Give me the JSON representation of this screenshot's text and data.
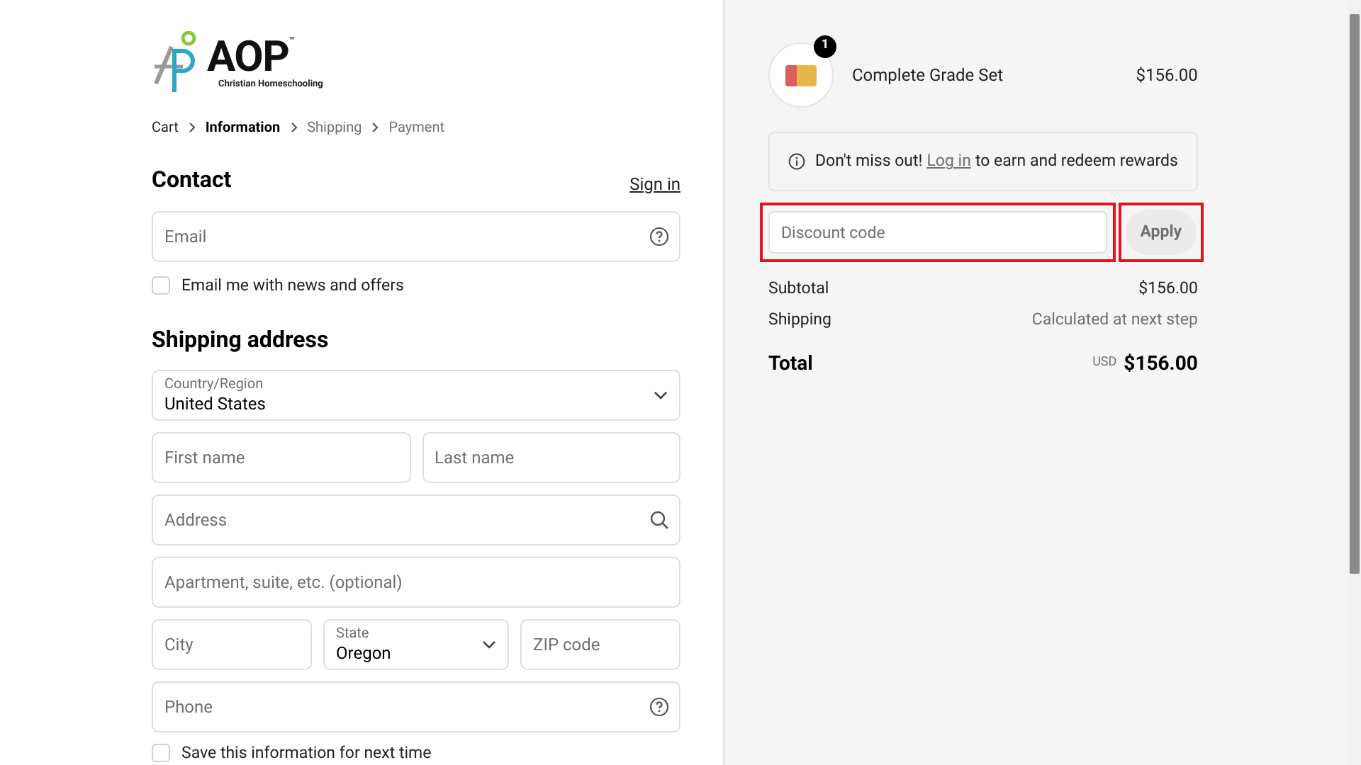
{
  "logo": {
    "name": "AOP",
    "trademark": "™",
    "tagline": "Christian Homeschooling"
  },
  "breadcrumb": [
    {
      "label": "Cart",
      "selected": false,
      "completed": true
    },
    {
      "label": "Information",
      "selected": true,
      "completed": false
    },
    {
      "label": "Shipping",
      "selected": false,
      "completed": false
    },
    {
      "label": "Payment",
      "selected": false,
      "completed": false
    }
  ],
  "contact": {
    "heading": "Contact",
    "sign_in": "Sign in",
    "email": {
      "kind": "help",
      "placeholder": "Email"
    },
    "newsletter": {
      "label": "Email me with news and offers",
      "checked": false
    }
  },
  "shipping": {
    "heading": "Shipping address",
    "rows": [
      [
        {
          "kind": "select",
          "label": "Country/Region",
          "value": "United States"
        }
      ],
      [
        {
          "kind": "text",
          "placeholder": "First name"
        },
        {
          "kind": "text",
          "placeholder": "Last name"
        }
      ],
      [
        {
          "kind": "search",
          "placeholder": "Address"
        }
      ],
      [
        {
          "kind": "text",
          "placeholder": "Apartment, suite, etc. (optional)"
        }
      ],
      [
        {
          "kind": "text",
          "placeholder": "City"
        },
        {
          "kind": "select",
          "label": "State",
          "value": "Oregon"
        },
        {
          "kind": "text",
          "placeholder": "ZIP code"
        }
      ],
      [
        {
          "kind": "help",
          "placeholder": "Phone"
        }
      ]
    ],
    "save_info": {
      "label": "Save this information for next time",
      "checked": false
    }
  },
  "summary": {
    "product": {
      "name": "Complete Grade Set",
      "quantity": "1",
      "price": "$156.00"
    },
    "notice": {
      "text": "Don't miss out!",
      "link": "Log in",
      "rest": "to earn and redeem rewards"
    },
    "discount": {
      "placeholder": "Discount code",
      "button": "Apply",
      "highlighted": true
    },
    "lines": [
      {
        "label": "Subtotal",
        "value": "$156.00",
        "muted": false
      },
      {
        "label": "Shipping",
        "value": "Calculated at next step",
        "muted": true
      }
    ],
    "total": {
      "label": "Total",
      "currency": "USD",
      "amount": "$156.00"
    }
  }
}
